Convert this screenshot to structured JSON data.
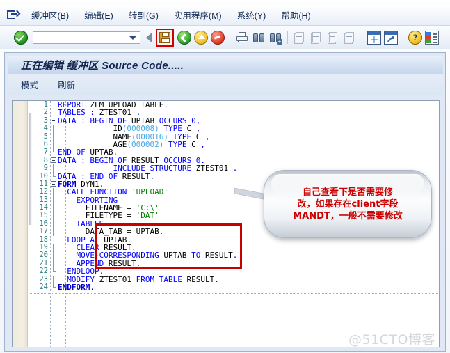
{
  "menu": {
    "exit_icon": "exit-icon",
    "items": [
      {
        "label": "缓冲区(B)"
      },
      {
        "label": "编辑(E)"
      },
      {
        "label": "转到(G)"
      },
      {
        "label": "实用程序(M)"
      },
      {
        "label": "系统(Y)"
      },
      {
        "label": "帮助(H)"
      }
    ]
  },
  "toolbar": {
    "enter_icon": "green-check-icon",
    "command_field": {
      "value": "",
      "placeholder": ""
    },
    "dropdown_icon": "chevron-down-icon",
    "back_tri_icon": "back-triangle-icon",
    "save_icon": "save-floppy-icon",
    "back_icon": "back-green-icon",
    "exit_icon": "exit-yellow-icon",
    "cancel_icon": "cancel-red-icon",
    "print_icon": "print-icon",
    "find_icon": "find-binoculars-icon",
    "find_next_icon": "find-next-binoculars-icon",
    "first_page_icon": "first-page-icon",
    "prev_page_icon": "previous-page-icon",
    "next_page_icon": "next-page-icon",
    "last_page_icon": "last-page-icon",
    "new_session_icon": "new-session-icon",
    "shortcut_icon": "create-shortcut-icon",
    "help_icon": "help-icon",
    "layout_icon": "customize-layout-icon"
  },
  "screen": {
    "title": "正在编辑 缓冲区 Source Code.....",
    "subtabs": [
      {
        "label": "模式"
      },
      {
        "label": "刷新"
      }
    ]
  },
  "editor": {
    "lines": [
      {
        "n": "1",
        "fold": "none",
        "html": "<span class=\"kw\">REPORT</span> <span class=\"id\">ZLM_UPLOAD_TABLE</span><span class=\"pn\">.</span>",
        "indent": 2
      },
      {
        "n": "2",
        "fold": "none",
        "html": "<span class=\"kw\">TABLES</span> <span class=\"pn\">:</span> <span class=\"id\">ZTEST01</span> <span class=\"pn\">.</span>",
        "indent": 2
      },
      {
        "n": "3",
        "fold": "start",
        "html": "<span class=\"kw\">DATA</span> <span class=\"pn\">:</span> <span class=\"kw\">BEGIN OF</span> <span class=\"id\">UPTAB</span> <span class=\"kw\">OCCURS</span> <span class=\"kw\">0</span><span class=\"pn\">,</span>",
        "indent": 0
      },
      {
        "n": "4",
        "fold": "mid",
        "html": "            <span class=\"id\">ID</span><span class=\"num\">(000008)</span> <span class=\"kw\">TYPE</span> <span class=\"id\">C</span> <span class=\"pn\">,</span>",
        "indent": 0
      },
      {
        "n": "5",
        "fold": "mid",
        "html": "            <span class=\"id\">NAME</span><span class=\"num\">(000016)</span> <span class=\"kw\">TYPE</span> <span class=\"id\">C</span> <span class=\"pn\">,</span>",
        "indent": 0
      },
      {
        "n": "6",
        "fold": "mid",
        "html": "            <span class=\"id\">AGE</span><span class=\"num\">(000002)</span> <span class=\"kw\">TYPE</span> <span class=\"id\">C</span> <span class=\"pn\">,</span>",
        "indent": 0
      },
      {
        "n": "7",
        "fold": "end",
        "html": "<span class=\"kw\">END OF</span> <span class=\"id\">UPTAB</span><span class=\"pn\">.</span>",
        "indent": 1
      },
      {
        "n": "8",
        "fold": "start",
        "html": "<span class=\"kw\">DATA</span> <span class=\"pn\">:</span> <span class=\"kw\">BEGIN OF</span> <span class=\"id\">RESULT</span> <span class=\"kw\">OCCURS</span> <span class=\"kw\">0</span><span class=\"pn\">.</span>",
        "indent": 0
      },
      {
        "n": "9",
        "fold": "mid",
        "html": "            <span class=\"kw\">INCLUDE STRUCTURE</span> <span class=\"id\">ZTEST01</span> <span class=\"pn\">.</span>",
        "indent": 0
      },
      {
        "n": "10",
        "fold": "end",
        "html": "<span class=\"kw\">DATA</span> <span class=\"pn\">:</span> <span class=\"kw\">END OF</span> <span class=\"id\">RESULT</span><span class=\"pn\">.</span>",
        "indent": 1
      },
      {
        "n": "11",
        "fold": "start",
        "html": "<span class=\"kwb\">FORM</span> <span class=\"id\">DYN1</span><span class=\"pn\">.</span>",
        "indent": 0
      },
      {
        "n": "12",
        "fold": "mid",
        "html": "  <span class=\"kw\">CALL FUNCTION</span> <span class=\"str\">'UPLOAD'</span>",
        "indent": 0
      },
      {
        "n": "13",
        "fold": "mid",
        "html": "    <span class=\"kw\">EXPORTING</span>",
        "indent": 0
      },
      {
        "n": "14",
        "fold": "mid",
        "html": "      <span class=\"id\">FILENAME</span> <span class=\"id\">=</span> <span class=\"str\">'C:\\'</span>",
        "indent": 0
      },
      {
        "n": "15",
        "fold": "mid",
        "html": "      <span class=\"id\">FILETYPE</span> <span class=\"id\">=</span> <span class=\"str\">'DAT'</span>",
        "indent": 0
      },
      {
        "n": "16",
        "fold": "mid",
        "html": "    <span class=\"kw\">TABLES</span>",
        "indent": 0
      },
      {
        "n": "17",
        "fold": "mid",
        "html": "      <span class=\"id\">DATA_TAB</span> <span class=\"id\">=</span> <span class=\"id\">UPTAB</span><span class=\"pn\">.</span>",
        "indent": 0
      },
      {
        "n": "18",
        "fold": "start2",
        "html": "  <span class=\"kw\">LOOP AT</span> <span class=\"id\">UPTAB</span><span class=\"pn\">.</span>",
        "indent": 0
      },
      {
        "n": "19",
        "fold": "mid",
        "html": "    <span class=\"kw\">CLEAR</span> <span class=\"id\">RESULT</span><span class=\"pn\">.</span>",
        "indent": 0
      },
      {
        "n": "20",
        "fold": "mid",
        "html": "    <span class=\"kw\">MOVE-CORRESPONDING</span> <span class=\"id\">UPTAB</span> <span class=\"kw\">TO</span> <span class=\"id\">RESULT</span><span class=\"pn\">.</span>",
        "indent": 0
      },
      {
        "n": "21",
        "fold": "mid",
        "html": "    <span class=\"kw\">APPEND</span> <span class=\"id\">RESULT</span><span class=\"pn\">.</span>",
        "indent": 0
      },
      {
        "n": "22",
        "fold": "end2",
        "html": "  <span class=\"kw\">ENDLOOP</span><span class=\"pn\">.</span>",
        "indent": 0
      },
      {
        "n": "23",
        "fold": "mid",
        "html": "  <span class=\"kw\">MODIFY</span> <span class=\"id\">ZTEST01</span> <span class=\"kw\">FROM TABLE</span> <span class=\"id\">RESULT</span><span class=\"pn\">.</span>",
        "indent": 0
      },
      {
        "n": "24",
        "fold": "end",
        "html": "<span class=\"kwb\">ENDFORM</span><span class=\"pn\">.</span>",
        "indent": 1
      }
    ]
  },
  "annotations": {
    "highlight_box": {
      "name": "red-highlight-box",
      "color": "#c90000"
    },
    "callout": {
      "color": "#cc0000",
      "lines": [
        "自己查看下是否需要修",
        "改，如果存在client字段",
        "MANDT，一般不需要修改"
      ]
    }
  },
  "watermark": {
    "text": "@51CTO博客"
  }
}
